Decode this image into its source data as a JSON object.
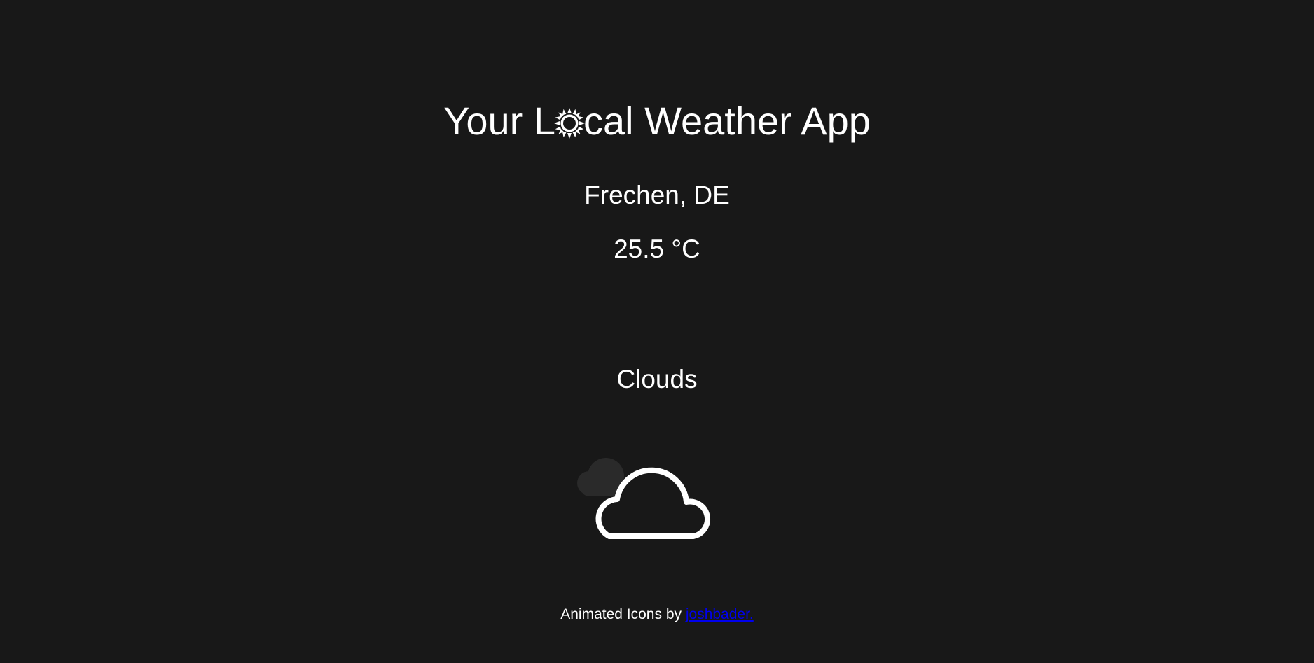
{
  "header": {
    "title_before": "Your L",
    "title_icon": "sun-icon",
    "title_after": "cal Weather App"
  },
  "weather": {
    "location": "Frechen, DE",
    "temperature": "25.5 °C",
    "condition": "Clouds",
    "icon": "cloud-icon"
  },
  "footer": {
    "credit_text": "Animated Icons by",
    "credit_link": "joshbader."
  },
  "colors": {
    "background": "#181818",
    "text": "#ffffff",
    "link": "#0000ee"
  }
}
